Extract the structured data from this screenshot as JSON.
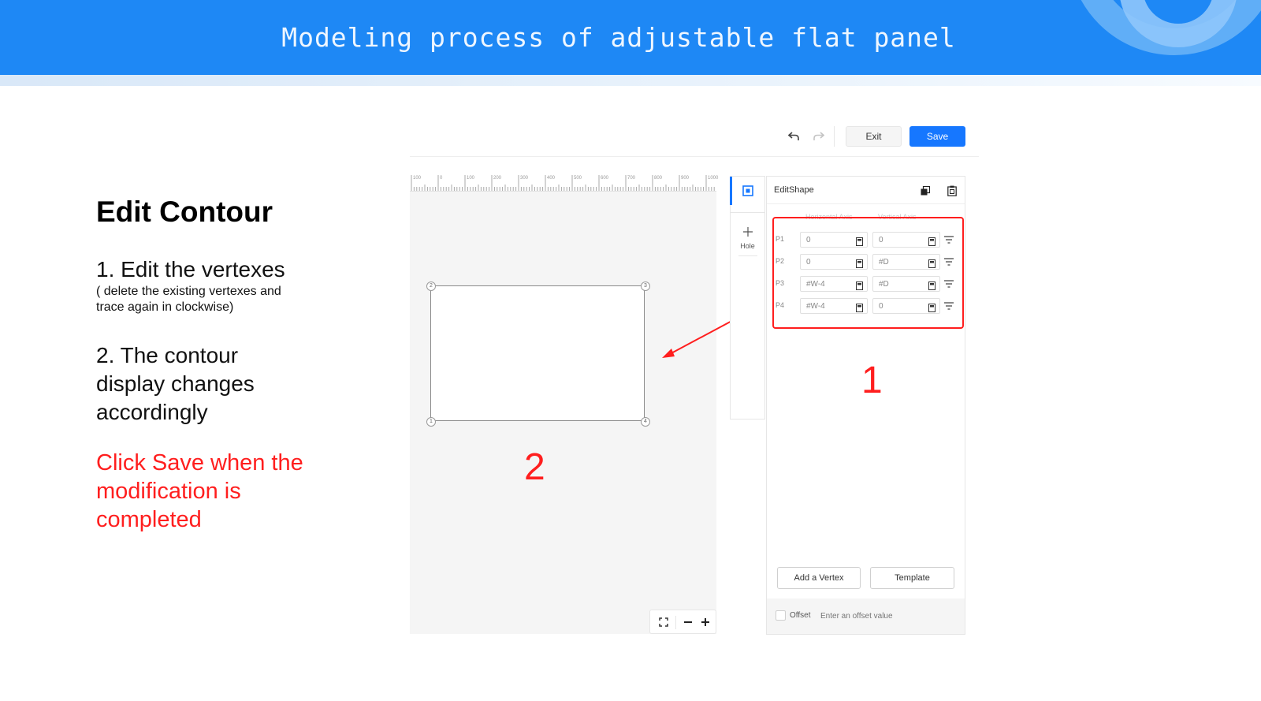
{
  "banner": {
    "title": "Modeling process of adjustable flat panel"
  },
  "instructions": {
    "heading": "Edit Contour",
    "step1": "1. Edit the vertexes",
    "step1_note_line1": "( delete the existing vertexes and",
    "step1_note_line2": "trace again in clockwise)",
    "step2_line1": "2. The contour",
    "step2_line2": "display changes",
    "step2_line3": "accordingly",
    "note_line1": "Click Save when the",
    "note_line2": "modification is",
    "note_line3": "completed"
  },
  "toolbar": {
    "exit_label": "Exit",
    "save_label": "Save",
    "save_color": "#1677ff"
  },
  "ruler": {
    "ticks": [
      "100",
      "0",
      "100",
      "200",
      "300",
      "400",
      "500",
      "600",
      "700",
      "800",
      "900",
      "1000"
    ]
  },
  "canvas": {
    "vertex_labels": [
      "1",
      "2",
      "3",
      "4"
    ]
  },
  "rail": {
    "hole_label": "Hole"
  },
  "panel": {
    "title": "EditShape",
    "col_horizontal": "Horizontal Axis",
    "col_vertical": "Vertical Axis",
    "vertices": [
      {
        "label": "P1",
        "h": "0",
        "v": "0"
      },
      {
        "label": "P2",
        "h": "0",
        "v": "#D"
      },
      {
        "label": "P3",
        "h": "#W-4",
        "v": "#D"
      },
      {
        "label": "P4",
        "h": "#W-4",
        "v": "0"
      }
    ],
    "add_vertex_label": "Add a Vertex",
    "template_label": "Template",
    "offset_label": "Offset",
    "offset_placeholder": "Enter an offset value"
  },
  "annotations": {
    "marker1": "1",
    "marker2": "2",
    "highlight_color": "#ff1e1e"
  }
}
